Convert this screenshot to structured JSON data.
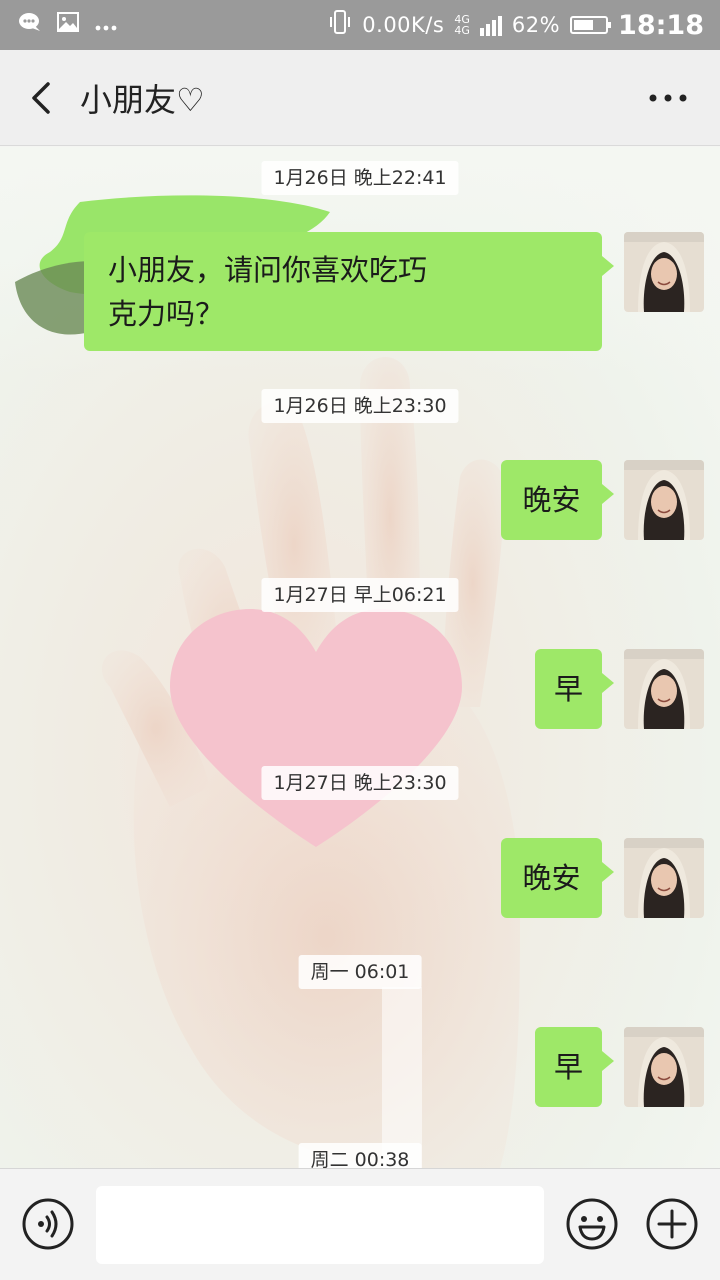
{
  "status_bar": {
    "speed": "0.00K/s",
    "network_top": "4G",
    "network_bottom": "4G",
    "battery_percent": "62%",
    "battery_level": 0.62,
    "time": "18:18"
  },
  "header": {
    "title": "小朋友♡"
  },
  "messages": [
    {
      "timestamp": "1月26日 晚上22:41",
      "text_line1": "小朋友，请问你喜欢吃巧",
      "text_line2": "克力吗？"
    },
    {
      "timestamp": "1月26日 晚上23:30",
      "text": "晚安"
    },
    {
      "timestamp": "1月27日 早上06:21",
      "text": "早"
    },
    {
      "timestamp": "1月27日 晚上23:30",
      "text": "晚安"
    },
    {
      "timestamp": "周一 06:01",
      "text": "早"
    },
    {
      "timestamp": "周二 00:38"
    }
  ],
  "input": {
    "placeholder": ""
  },
  "colors": {
    "bubble": "#9ee868",
    "status_bar": "#9a9a9a",
    "heart": "#f5c3cd"
  },
  "icons": {
    "back": "chevron-left-icon",
    "more": "more-dots-icon",
    "voice": "voice-icon",
    "emoji": "emoji-icon",
    "plus": "plus-icon"
  }
}
